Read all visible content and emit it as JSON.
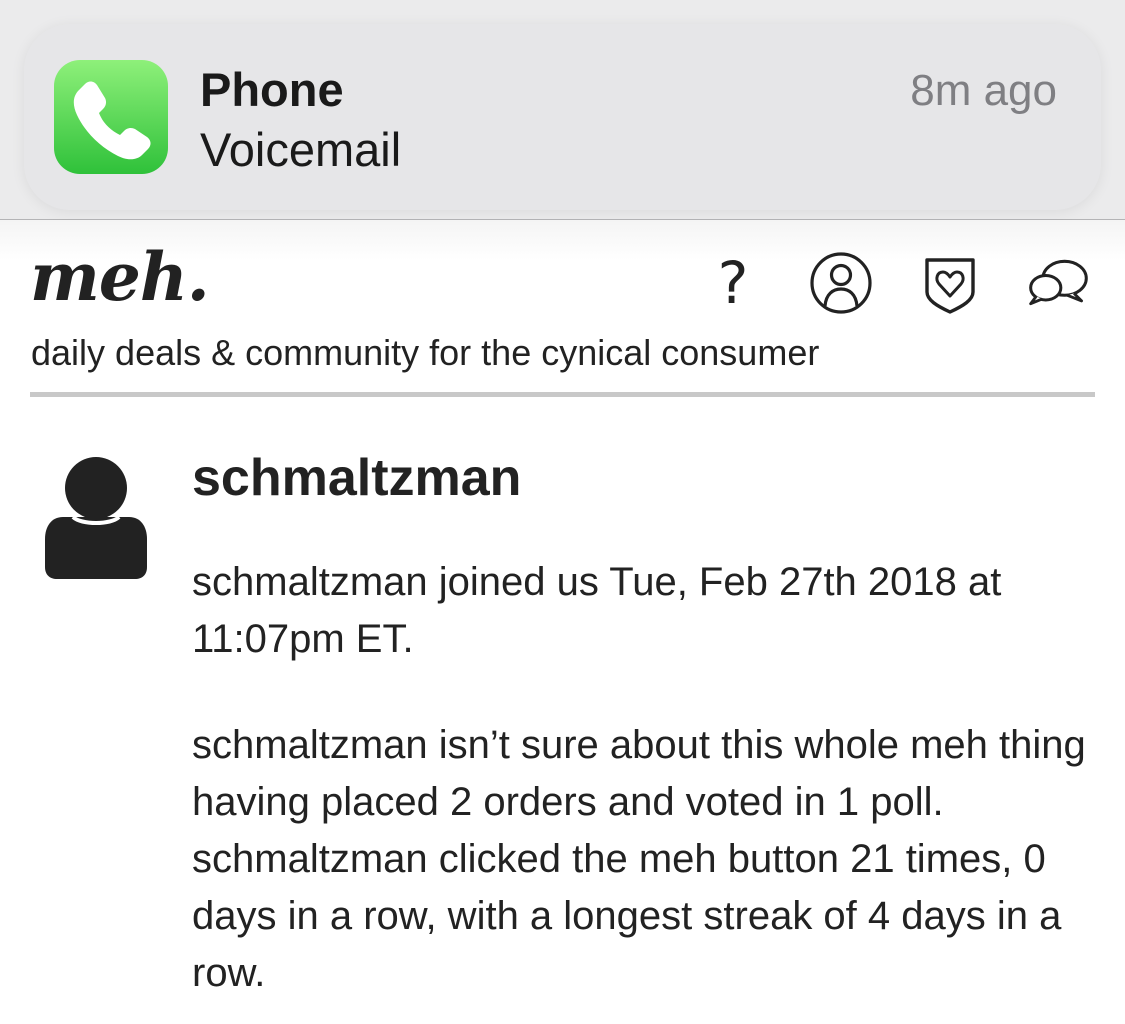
{
  "notification": {
    "app_name": "Phone",
    "message": "Voicemail",
    "time": "8m ago",
    "icon": "phone-icon",
    "accent": "#4cd964"
  },
  "header": {
    "logo": "meh.",
    "tagline": "daily deals & community for the cynical consumer",
    "nav_icons": [
      "help-icon",
      "account-icon",
      "deals-shield-icon",
      "forum-chat-icon"
    ],
    "help_glyph": "?"
  },
  "profile": {
    "avatar_icon": "user-silhouette-icon",
    "username": "schmaltzman",
    "joined": "schmaltzman joined us Tue, Feb 27th 2018 at 11:07pm ET.",
    "stats": "schmaltzman isn’t sure about this whole meh thing having placed 2 orders and voted in 1 poll. schmaltzman clicked the meh button 21 times, 0 days in a row, with a longest streak of 4 days in a row."
  }
}
